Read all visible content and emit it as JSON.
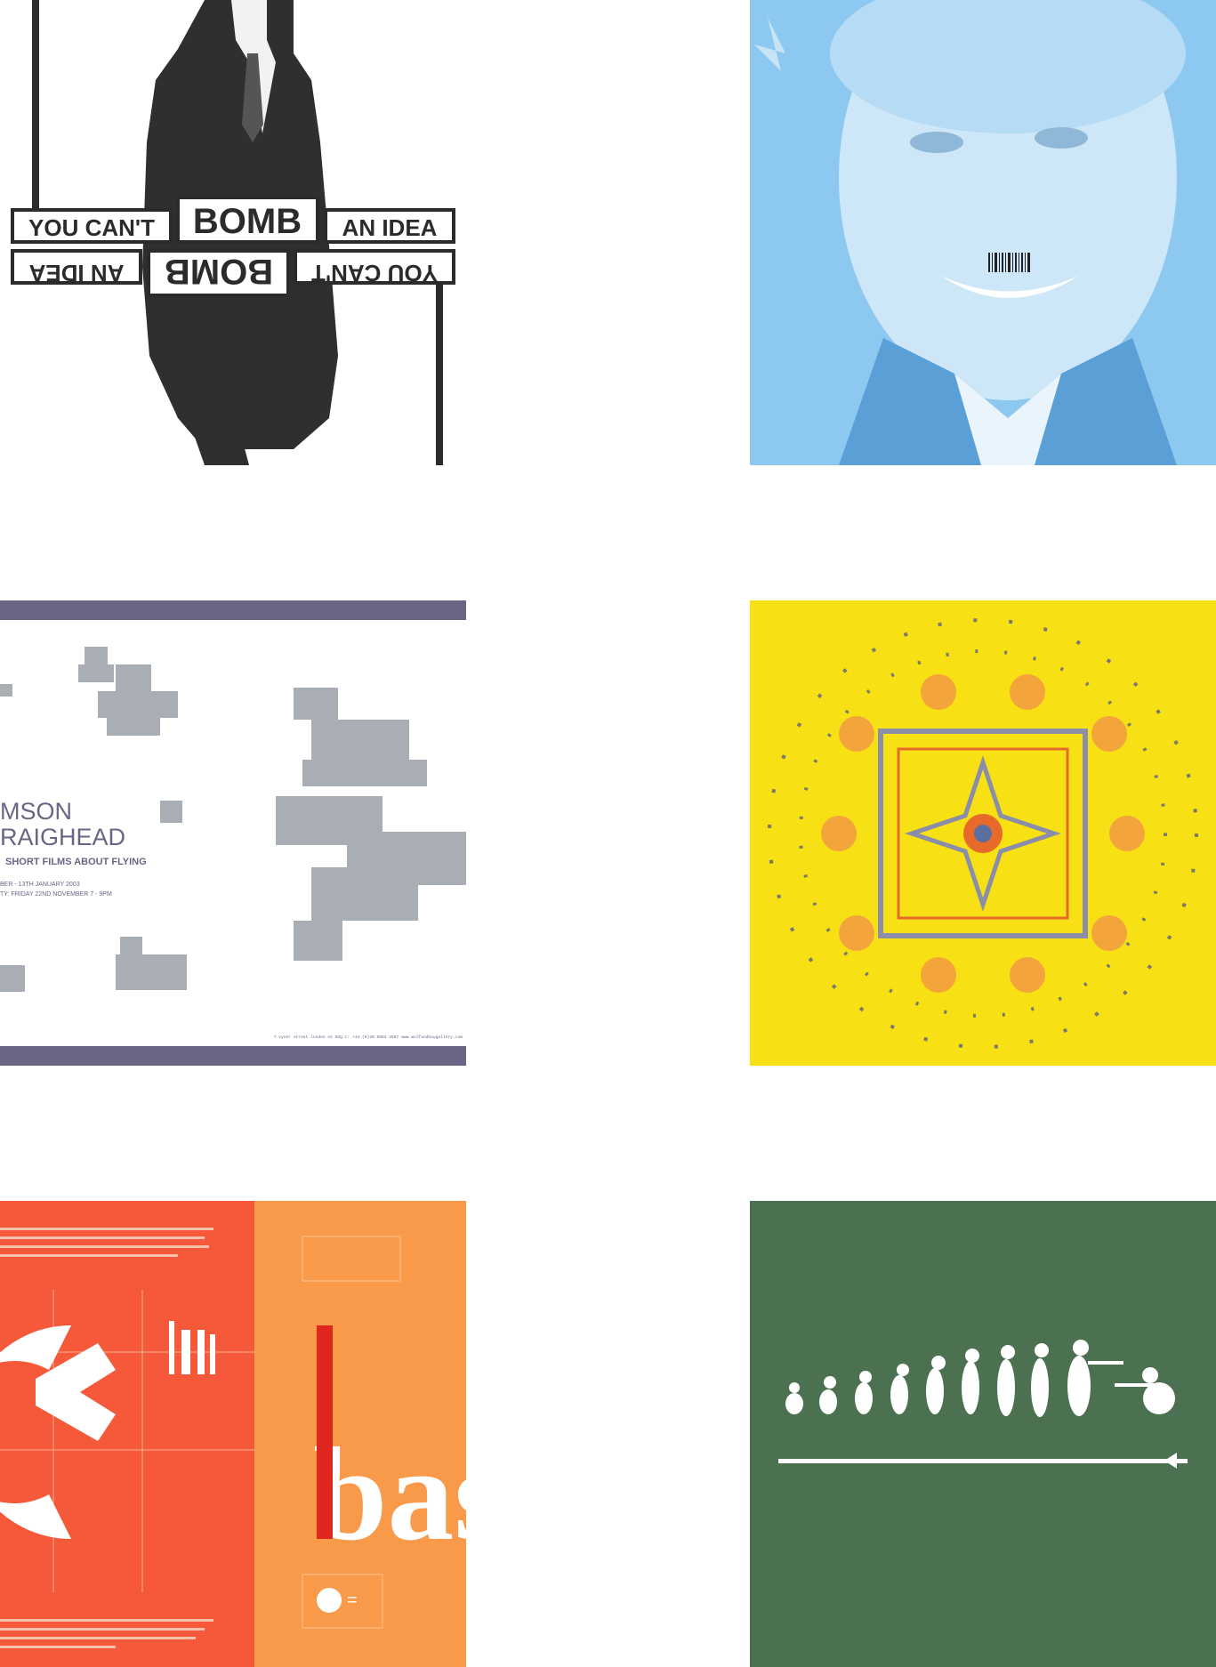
{
  "gallery": {
    "items": [
      {
        "name": "bomb-idea-poster",
        "sign": {
          "row_top": [
            "YOU CAN'T",
            "BOMB",
            "AN IDEA"
          ],
          "row_bottom": [
            "YOU CAN'T",
            "BOMB",
            "AN IDEA"
          ]
        }
      },
      {
        "name": "barcode-smile-portrait"
      },
      {
        "name": "flying-films-poster",
        "title_line1": "MSON",
        "title_line2": "RAIGHEAD",
        "subtitle": "SHORT FILMS ABOUT FLYING",
        "dates": "BER - 13TH JANUARY 2003",
        "preview": "TY: FRIDAY 22ND NOVEMBER 7 - 9PM",
        "footer": "7 vyner street  london e2 9dg  t: +44 (0)20 8983 4567  www.wolfandhaygallery.com"
      },
      {
        "name": "yellow-mandala-pattern"
      },
      {
        "name": "orange-typography-poster",
        "glyphs": "bast"
      },
      {
        "name": "evolution-to-soldier"
      }
    ]
  },
  "colors": {
    "poster_purple": "#6b6585",
    "sky_blue": "#8cc8f0",
    "mandala_yellow": "#f7e013",
    "poster_red": "#f5593a",
    "poster_orange": "#f99a4a",
    "evolution_green": "#4b7150"
  }
}
